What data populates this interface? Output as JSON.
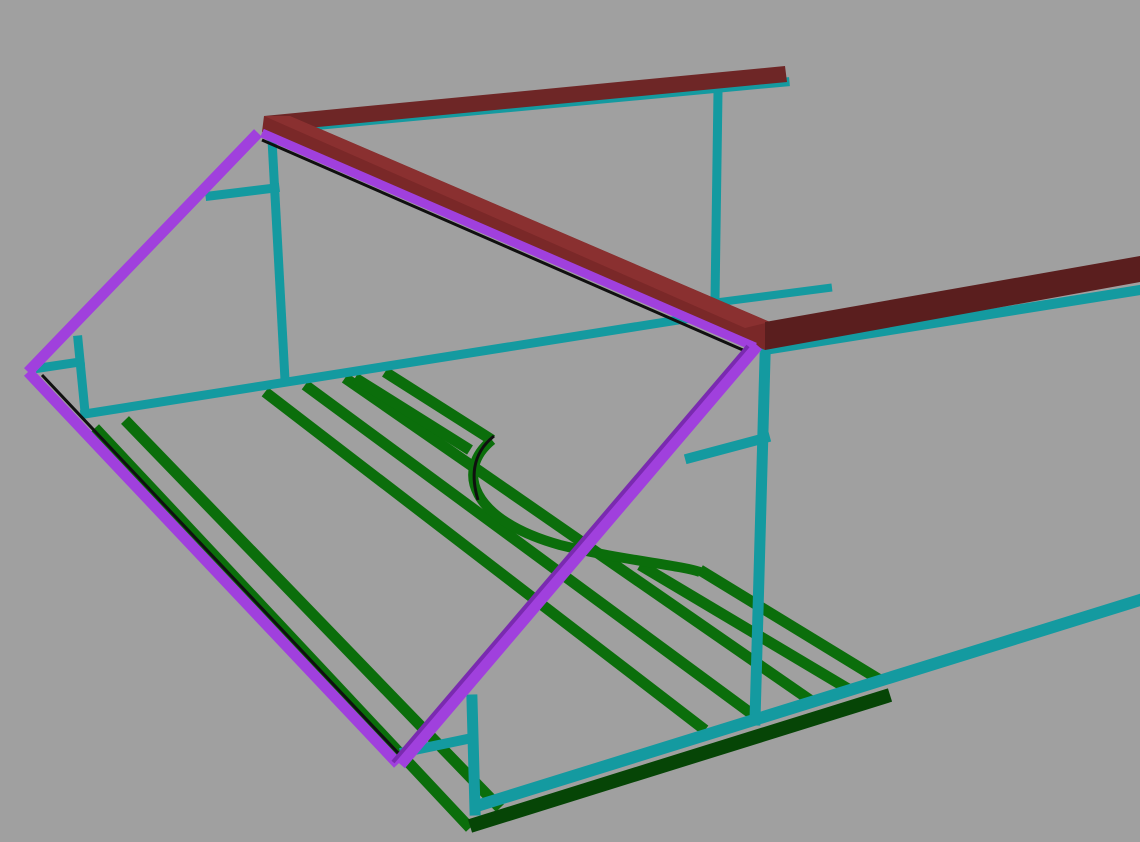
{
  "viewport": {
    "background": "#a0a0a0",
    "colors": {
      "frame_cyan": "#149aa0",
      "frame_cyan_dark": "#0c6e74",
      "floor_green": "#0b6e0b",
      "floor_green_dark": "#064506",
      "roof_brown": "#6e2626",
      "roof_brown_light": "#8a3030",
      "gable_purple": "#a040dd",
      "gable_purple_dark": "#7a2ab0",
      "shadow": "#101010"
    }
  }
}
